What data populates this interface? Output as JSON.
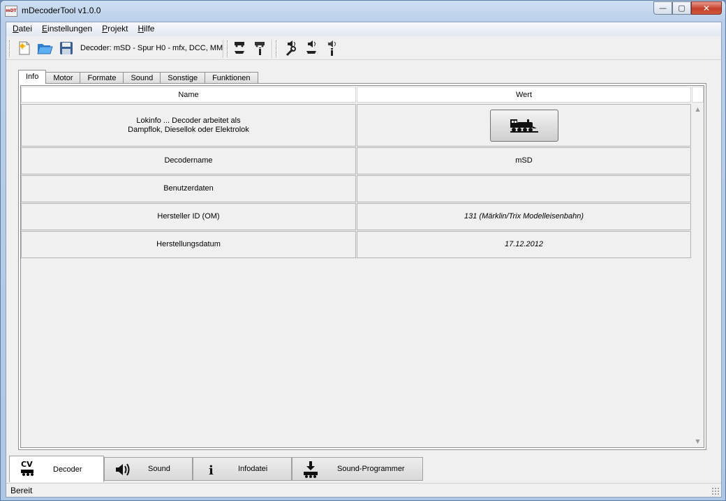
{
  "window": {
    "title": "mDecoderTool v1.0.0",
    "app_icon_text": "mDT",
    "minimize": "—",
    "maximize": "▢",
    "close": "✕"
  },
  "menu": [
    {
      "label": "Datei",
      "key": "D",
      "rest": "atei"
    },
    {
      "label": "Einstellungen",
      "key": "E",
      "rest": "instellungen"
    },
    {
      "label": "Projekt",
      "key": "P",
      "rest": "rojekt"
    },
    {
      "label": "Hilfe",
      "key": "H",
      "rest": "ilfe"
    }
  ],
  "toolbar": {
    "decoder_label": "Decoder: mSD - Spur H0 - mfx, DCC, MM",
    "icons": [
      "new-file-icon",
      "open-folder-icon",
      "save-icon",
      "decoder-write-icon",
      "decoder-info-icon",
      "sound-tools-icon",
      "sound-write-icon",
      "sound-info-icon"
    ]
  },
  "tabs": [
    "Info",
    "Motor",
    "Formate",
    "Sound",
    "Sonstige",
    "Funktionen"
  ],
  "active_tab": "Info",
  "table": {
    "headers": {
      "name": "Name",
      "value": "Wert"
    },
    "rows": [
      {
        "name_line1": "Lokinfo ... Decoder arbeitet als",
        "name_line2": "Dampflok, Diesellok oder Elektrolok",
        "value": "",
        "type": "button"
      },
      {
        "name": "Decodername",
        "value": "mSD",
        "italic": false
      },
      {
        "name": "Benutzerdaten",
        "value": "",
        "italic": false
      },
      {
        "name": "Hersteller ID (OM)",
        "value": "131 (Märklin/Trix Modelleisenbahn)",
        "italic": true
      },
      {
        "name": "Herstellungsdatum",
        "value": "17.12.2012",
        "italic": true
      }
    ]
  },
  "bottom_tabs": [
    {
      "label": "Decoder",
      "icon_text": "CV",
      "icon": "cv-locomotive-icon"
    },
    {
      "label": "Sound",
      "icon": "speaker-icon"
    },
    {
      "label": "Infodatei",
      "icon_text": "i",
      "icon": "info-icon"
    },
    {
      "label": "Sound-Programmer",
      "icon": "download-locomotive-icon"
    }
  ],
  "status": {
    "text": "Bereit"
  }
}
